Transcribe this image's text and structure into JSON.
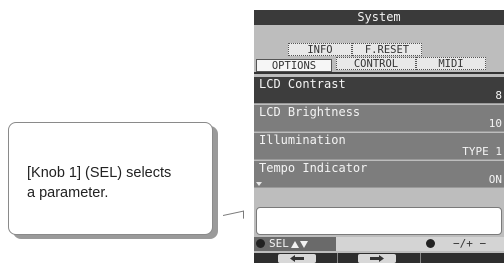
{
  "callout": {
    "text": "[Knob 1] (SEL) selects\na parameter."
  },
  "lcd": {
    "title": "System",
    "top_tabs": [
      "INFO",
      "F.RESET"
    ],
    "bottom_tabs": [
      "OPTIONS",
      "CONTROL",
      "MIDI"
    ],
    "active_tab": "OPTIONS",
    "params": [
      {
        "label": "LCD Contrast",
        "value": "8",
        "selected": true
      },
      {
        "label": "LCD Brightness",
        "value": "10",
        "selected": false
      },
      {
        "label": "Illumination",
        "value": "TYPE 1",
        "selected": false
      },
      {
        "label": "Tempo Indicator",
        "value": "ON",
        "selected": false
      }
    ],
    "knob1": {
      "label": "SEL",
      "icon": "up-down-arrows-icon"
    },
    "knob2": {
      "label": "−/+ −"
    },
    "function_keys": [
      {
        "icon": "previous-icon"
      },
      {
        "icon": "next-icon"
      }
    ]
  }
}
